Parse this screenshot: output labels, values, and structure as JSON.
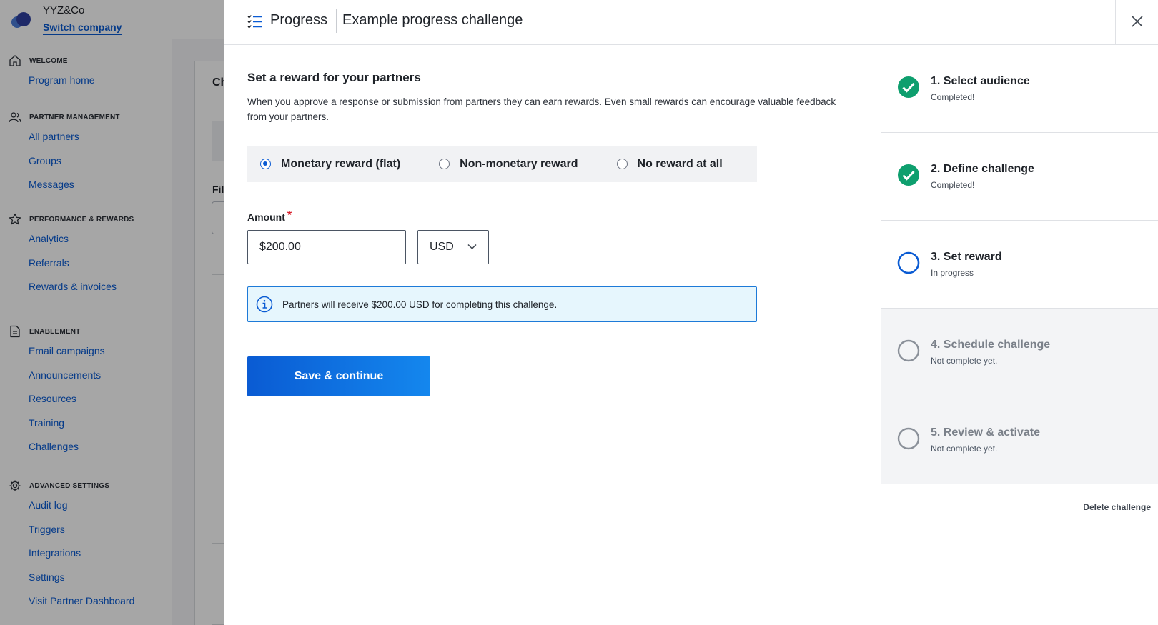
{
  "brand": {
    "company": "YYZ&Co",
    "switch_label": "Switch company"
  },
  "sidebar": {
    "sections": [
      {
        "heading": "WELCOME",
        "icon": "home-icon",
        "items": [
          "Program home"
        ]
      },
      {
        "heading": "PARTNER MANAGEMENT",
        "icon": "users-icon",
        "items": [
          "All partners",
          "Groups",
          "Messages"
        ]
      },
      {
        "heading": "PERFORMANCE & REWARDS",
        "icon": "star-icon",
        "items": [
          "Analytics",
          "Referrals",
          "Rewards & invoices"
        ]
      },
      {
        "heading": "ENABLEMENT",
        "icon": "document-icon",
        "items": [
          "Email campaigns",
          "Announcements",
          "Resources",
          "Training",
          "Challenges"
        ]
      },
      {
        "heading": "ADVANCED SETTINGS",
        "icon": "gear-icon",
        "items": [
          "Audit log",
          "Triggers",
          "Integrations",
          "Settings",
          "Visit Partner Dashboard"
        ]
      }
    ]
  },
  "background": {
    "card_title_fragment": "Ch",
    "filter_fragment": "Fil"
  },
  "modal": {
    "progress_label": "Progress",
    "title": "Example progress challenge"
  },
  "form": {
    "heading": "Set a reward for your partners",
    "description": "When you approve a response or submission from partners they can earn rewards. Even small rewards can encourage valuable feedback from your partners.",
    "reward_options": [
      {
        "label": "Monetary reward (flat)",
        "selected": true
      },
      {
        "label": "Non-monetary reward",
        "selected": false
      },
      {
        "label": "No reward at all",
        "selected": false
      }
    ],
    "amount_label": "Amount",
    "required_mark": "*",
    "amount_value": "$200.00",
    "currency": "USD",
    "info_message": "Partners will receive $200.00 USD for completing this challenge.",
    "save_label": "Save & continue"
  },
  "steps": [
    {
      "title": "1. Select audience",
      "status": "Completed!",
      "state": "complete"
    },
    {
      "title": "2. Define challenge",
      "status": "Completed!",
      "state": "complete"
    },
    {
      "title": "3. Set reward",
      "status": "In progress",
      "state": "active"
    },
    {
      "title": "4. Schedule challenge",
      "status": "Not complete yet.",
      "state": "pending"
    },
    {
      "title": "5. Review & activate",
      "status": "Not complete yet.",
      "state": "pending"
    }
  ],
  "delete_label": "Delete challenge",
  "colors": {
    "accent": "#0a5bd3",
    "success": "#0e9f6e",
    "info_border": "#1d7ad8",
    "info_bg": "#e6f6fd"
  }
}
